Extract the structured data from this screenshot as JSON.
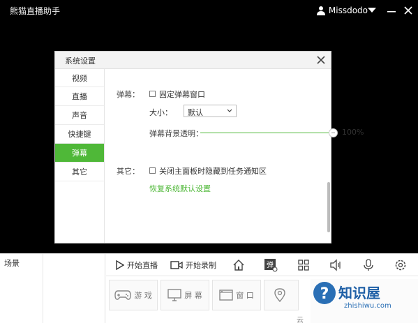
{
  "titlebar": {
    "app_title": "熊猫直播助手",
    "username": "Missdodo"
  },
  "modal": {
    "title": "系统设置",
    "sidebar": [
      {
        "label": "视频"
      },
      {
        "label": "直播"
      },
      {
        "label": "声音"
      },
      {
        "label": "快捷键"
      },
      {
        "label": "弹幕"
      },
      {
        "label": "其它"
      }
    ],
    "active_index": 4,
    "danmu": {
      "label": "弹幕：",
      "fix_window_label": "固定弹幕窗口",
      "fix_window_checked": false,
      "size_label": "大小：",
      "size_value": "默认",
      "bg_opacity_label": "弹幕背景透明：",
      "bg_opacity_percent": "100%",
      "bg_opacity_value": 1.0
    },
    "other": {
      "label": "其它：",
      "hide_tray_label": "关闭主面板时隐藏到任务通知区",
      "hide_tray_checked": false,
      "restore_link": "恢复系统默认设置"
    }
  },
  "bottom": {
    "scene_label": "场景",
    "start_live": "开始直播",
    "start_record": "开始录制",
    "sources": {
      "game": "游 戏",
      "screen": "屏 幕",
      "window": "窗 口"
    },
    "footer_text": "云"
  },
  "watermark": {
    "title": "知识屋",
    "url": "zhishiwu.com"
  },
  "colors": {
    "accent": "#4fb838",
    "titlebar_bg": "#000000",
    "watermark_blue": "#1e5fa6"
  }
}
